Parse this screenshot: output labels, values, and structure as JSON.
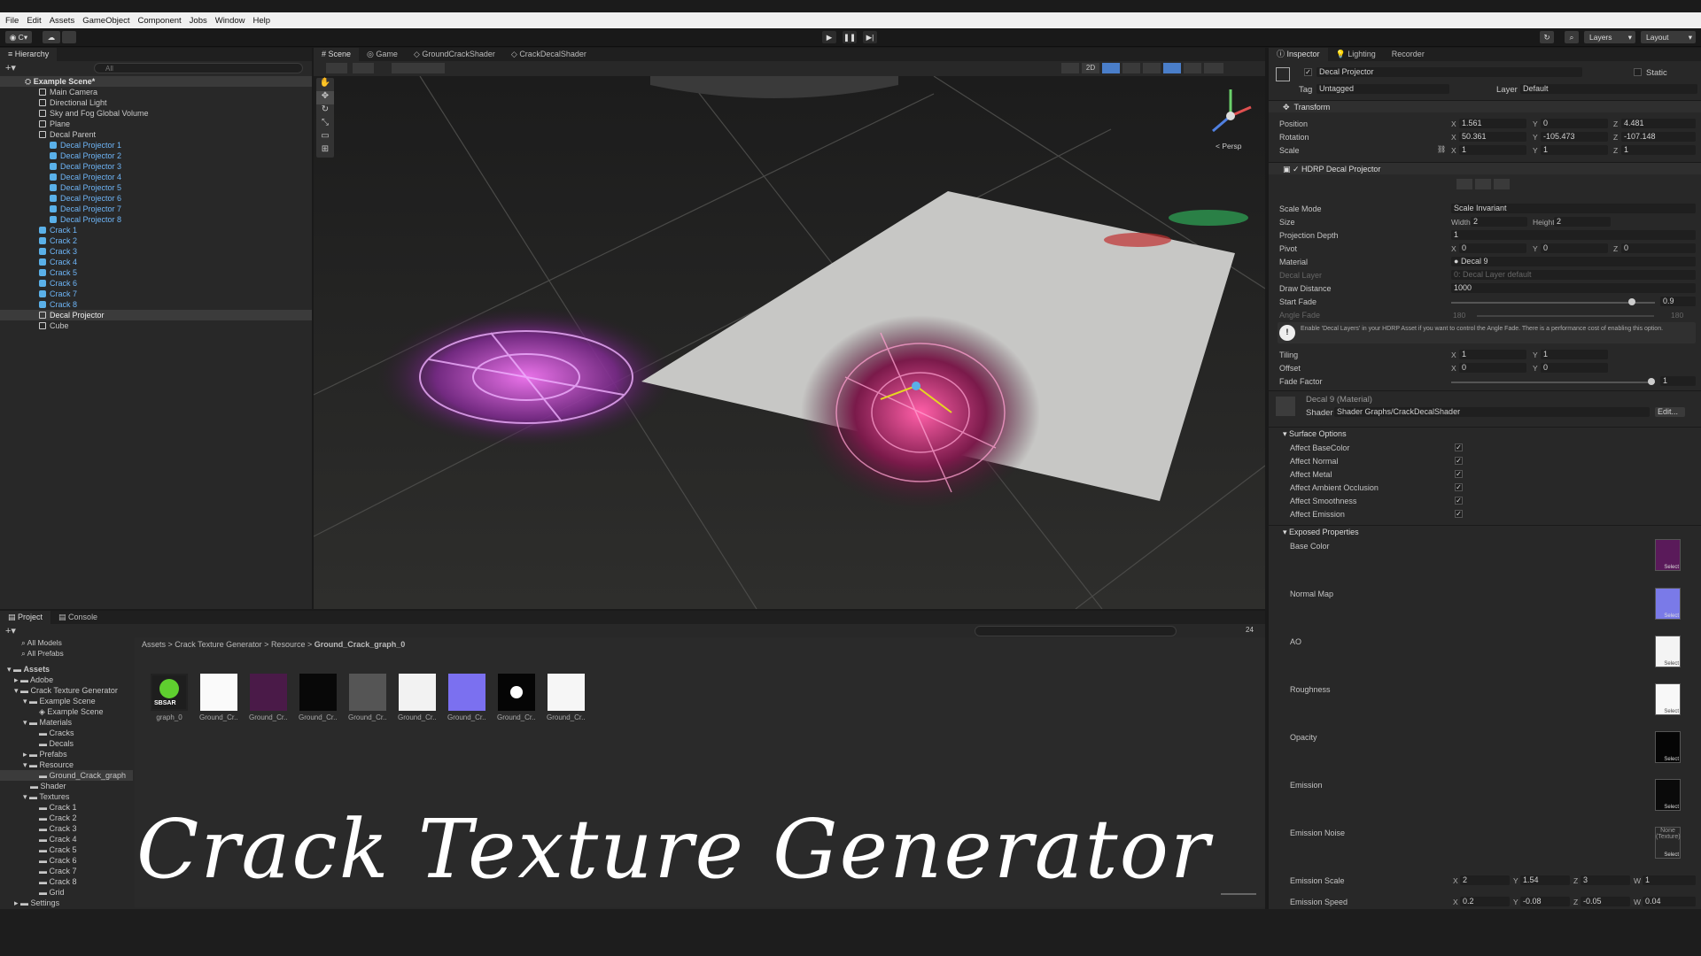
{
  "menu": [
    "File",
    "Edit",
    "Assets",
    "GameObject",
    "Component",
    "Jobs",
    "Window",
    "Help"
  ],
  "toolbar": {
    "account": "C",
    "layers": "Layers",
    "layout": "Layout"
  },
  "hierarchy": {
    "tab": "Hierarchy",
    "search_placeholder": "All",
    "scene": "Example Scene*",
    "items": [
      "Main Camera",
      "Directional Light",
      "Sky and Fog Global Volume",
      "Plane",
      "Decal Parent"
    ],
    "decals": [
      "Decal Projector 1",
      "Decal Projector 2",
      "Decal Projector 3",
      "Decal Projector 4",
      "Decal Projector 5",
      "Decal Projector 6",
      "Decal Projector 7",
      "Decal Projector 8"
    ],
    "cracks": [
      "Crack 1",
      "Crack 2",
      "Crack 3",
      "Crack 4",
      "Crack 5",
      "Crack 6",
      "Crack 7",
      "Crack 8"
    ],
    "tail": [
      "Decal Projector",
      "Cube"
    ]
  },
  "scene_tabs": [
    "Scene",
    "Game",
    "GroundCrackShader",
    "CrackDecalShader"
  ],
  "scene_view": {
    "persp": "< Persp",
    "two_d": "2D"
  },
  "inspector": {
    "tabs": [
      "Inspector",
      "Lighting",
      "Recorder"
    ],
    "object_name": "Decal Projector",
    "static": "Static",
    "tag_label": "Tag",
    "tag": "Untagged",
    "layer_label": "Layer",
    "layer": "Default",
    "transform": {
      "title": "Transform",
      "position": [
        "1.561",
        "0",
        "4.481"
      ],
      "rotation": [
        "50.361",
        "-105.473",
        "-107.148"
      ],
      "scale": [
        "1",
        "1",
        "1"
      ]
    },
    "hdrp": {
      "title": "HDRP Decal Projector",
      "scale_mode": "Scale Invariant",
      "width": "2",
      "height": "2",
      "projection_depth": "1",
      "pivot": [
        "0",
        "0",
        "0"
      ],
      "material": "Decal 9",
      "decal_layer": "0: Decal Layer default",
      "draw_distance": "1000",
      "start_fade": "0.9",
      "angle_fade": [
        "180",
        "180"
      ],
      "warning": "Enable 'Decal Layers' in your HDRP Asset if you want to control the Angle Fade. There is a performance cost of enabling this option.",
      "tiling": [
        "1",
        "1"
      ],
      "offset": [
        "0",
        "0"
      ],
      "fade_factor": "1"
    },
    "material": {
      "name": "Decal 9 (Material)",
      "shader_label": "Shader",
      "shader": "Shader Graphs/CrackDecalShader",
      "edit": "Edit..."
    },
    "surface": {
      "title": "Surface Options",
      "options": [
        "Affect BaseColor",
        "Affect Normal",
        "Affect Metal",
        "Affect Ambient Occlusion",
        "Affect Smoothness",
        "Affect Emission"
      ]
    },
    "exposed": {
      "title": "Exposed Properties",
      "props": [
        "Base Color",
        "Normal Map",
        "AO",
        "Roughness",
        "Opacity",
        "Emission",
        "Emission Noise"
      ],
      "none_texture": "None (Texture)",
      "select": "Select",
      "emission_scale": {
        "label": "Emission Scale",
        "x": "2",
        "y": "1.54",
        "z": "3",
        "w": "1"
      },
      "emission_speed": {
        "label": "Emission Speed",
        "x": "0.2",
        "y": "-0.08",
        "z": "-0.05",
        "w": "0.04"
      }
    },
    "labels": {
      "position": "Position",
      "rotation": "Rotation",
      "scale": "Scale",
      "scale_mode": "Scale Mode",
      "size": "Size",
      "width": "Width",
      "height": "Height",
      "projection_depth": "Projection Depth",
      "pivot": "Pivot",
      "material": "Material",
      "decal_layer": "Decal Layer",
      "draw_distance": "Draw Distance",
      "start_fade": "Start Fade",
      "angle_fade": "Angle Fade",
      "tiling": "Tiling",
      "offset": "Offset",
      "fade_factor": "Fade Factor"
    }
  },
  "project": {
    "tabs": [
      "Project",
      "Console"
    ],
    "favorites": [
      "All Models",
      "All Prefabs"
    ],
    "tree": [
      "Assets",
      "Adobe",
      "Crack Texture Generator",
      "Example Scene",
      "Example Scene",
      "Materials",
      "Cracks",
      "Decals",
      "Prefabs",
      "Resource",
      "Ground_Crack_graph",
      "Shader",
      "Textures",
      "Crack 1",
      "Crack 2",
      "Crack 3",
      "Crack 4",
      "Crack 5",
      "Crack 6",
      "Crack 7",
      "Crack 8",
      "Grid",
      "Settings"
    ],
    "breadcrumb": [
      "Assets",
      "Crack Texture Generator",
      "Resource",
      "Ground_Crack_graph_0"
    ],
    "assets": [
      "graph_0",
      "Ground_Cr...",
      "Ground_Cr...",
      "Ground_Cr...",
      "Ground_Cr...",
      "Ground_Cr...",
      "Ground_Cr...",
      "Ground_Cr...",
      "Ground_Cr..."
    ],
    "sbsar": "SBSAR",
    "count": "24"
  },
  "overlay_title": "Crack Texture Generator"
}
